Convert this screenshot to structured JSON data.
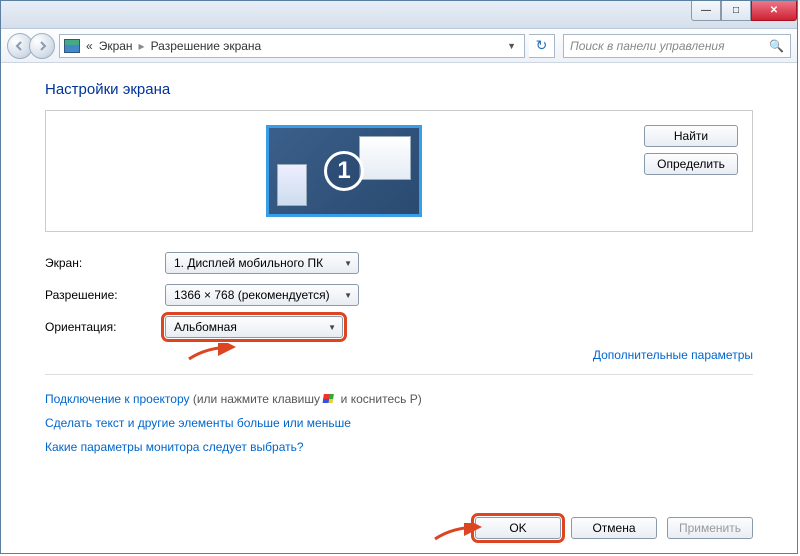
{
  "titlebar": {
    "min_icon": "—",
    "max_icon": "□",
    "close_icon": "✕"
  },
  "address": {
    "prefix": "«",
    "crumb1": "Экран",
    "crumb2": "Разрешение экрана"
  },
  "search": {
    "placeholder": "Поиск в панели управления"
  },
  "heading": "Настройки экрана",
  "monitor_number": "1",
  "side_buttons": {
    "find": "Найти",
    "detect": "Определить"
  },
  "form": {
    "display_label": "Экран:",
    "display_value": "1. Дисплей мобильного ПК",
    "resolution_label": "Разрешение:",
    "resolution_value": "1366 × 768 (рекомендуется)",
    "orientation_label": "Ориентация:",
    "orientation_value": "Альбомная"
  },
  "advanced_link": "Дополнительные параметры",
  "info": {
    "projector_link": "Подключение к проектору",
    "projector_suffix_a": " (или нажмите клавишу ",
    "projector_suffix_b": " и коснитесь P)",
    "resize_link": "Сделать текст и другие элементы больше или меньше",
    "help_link": "Какие параметры монитора следует выбрать?"
  },
  "footer": {
    "ok": "OK",
    "cancel": "Отмена",
    "apply": "Применить"
  }
}
